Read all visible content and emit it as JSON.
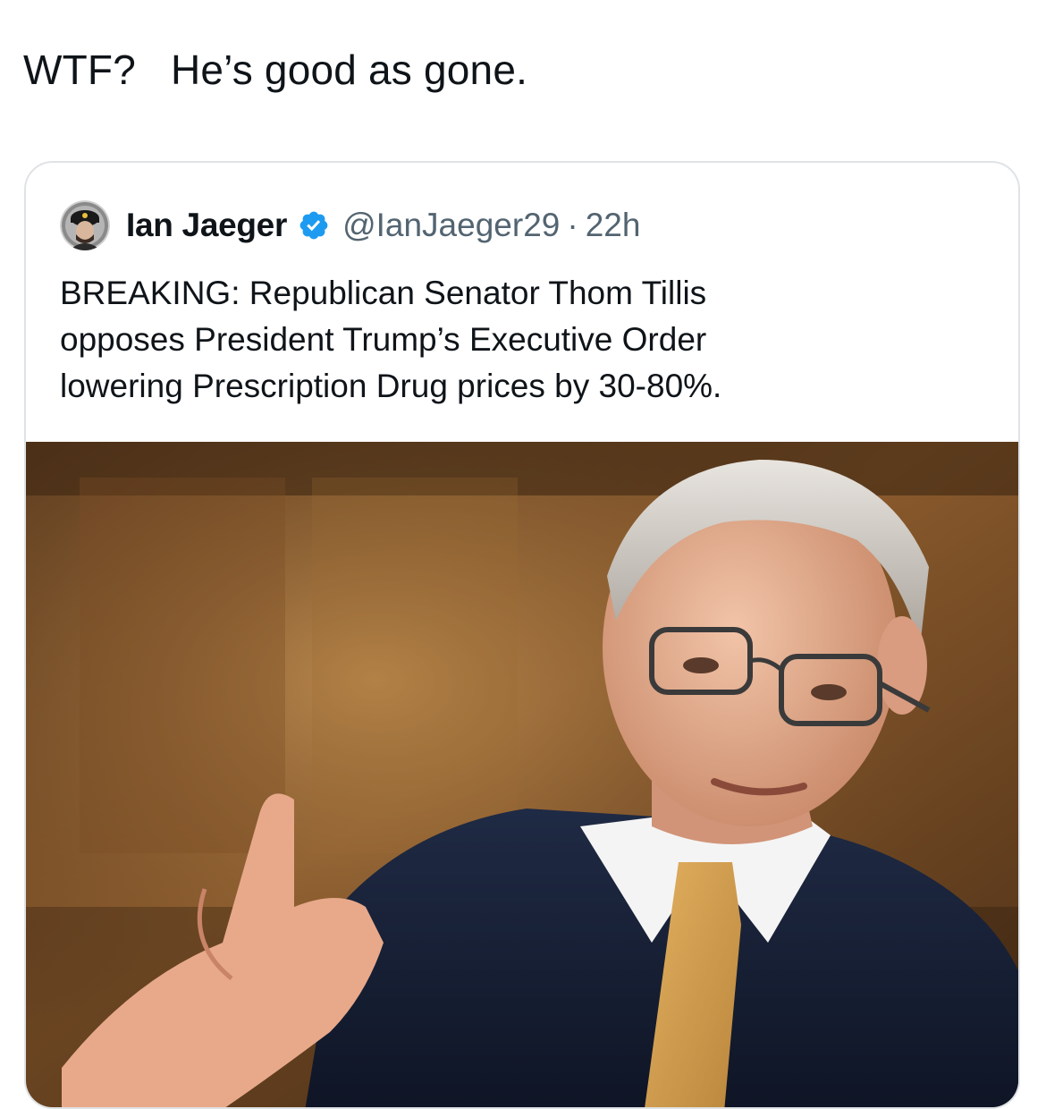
{
  "post": {
    "text": "WTF?   He’s good as gone."
  },
  "quoted_post": {
    "author": {
      "display_name": "Ian Jaeger",
      "handle": "@IanJaeger29",
      "verified": true
    },
    "separator": "·",
    "time_ago": "22h",
    "text_lines": [
      "BREAKING: Republican Senator Thom Tillis",
      "opposes President Trump’s Executive Order",
      "lowering Prescription Drug prices by 30-80%."
    ],
    "media": {
      "kind": "photo"
    }
  },
  "colors": {
    "text_primary": "#0f1419",
    "text_secondary": "#536471",
    "border": "#dfe3e6",
    "verified_badge": "#1d9bf0"
  },
  "icons": {
    "verified": "verified-badge-icon",
    "avatar": "user-avatar"
  }
}
